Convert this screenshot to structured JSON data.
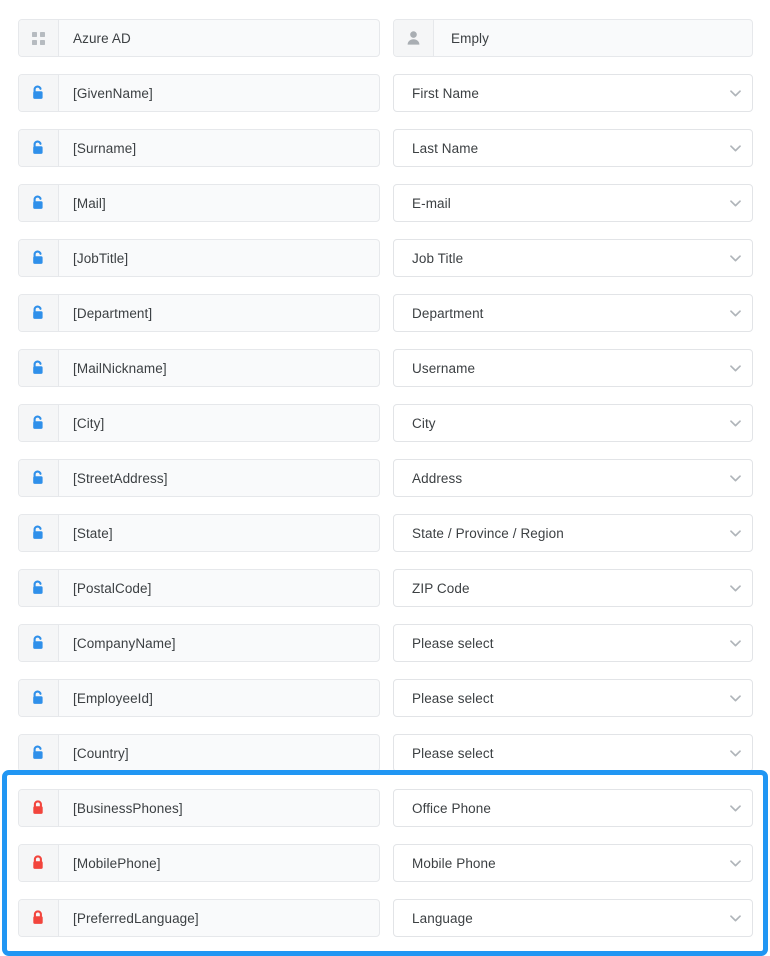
{
  "header": {
    "left": {
      "icon": "grid-icon",
      "label": "Azure AD"
    },
    "right": {
      "icon": "person-icon",
      "label": "Emply"
    }
  },
  "colors": {
    "highlight_border": "#2196f3",
    "lock_open": "#2f90ea",
    "lock_closed": "#f2453d",
    "row_background": "#f9fafb",
    "dropdown_background": "#ffffff"
  },
  "highlight": {
    "visible": true,
    "covers_rows": [
      "[BusinessPhones]",
      "[MobilePhone]",
      "[PreferredLanguage]"
    ]
  },
  "rows": [
    {
      "source": "[GivenName]",
      "target": "First Name",
      "lock": "lock-open-icon",
      "locked": false,
      "highlighted": false
    },
    {
      "source": "[Surname]",
      "target": "Last Name",
      "lock": "lock-open-icon",
      "locked": false,
      "highlighted": false
    },
    {
      "source": "[Mail]",
      "target": "E-mail",
      "lock": "lock-open-icon",
      "locked": false,
      "highlighted": false
    },
    {
      "source": "[JobTitle]",
      "target": "Job Title",
      "lock": "lock-open-icon",
      "locked": false,
      "highlighted": false
    },
    {
      "source": "[Department]",
      "target": "Department",
      "lock": "lock-open-icon",
      "locked": false,
      "highlighted": false
    },
    {
      "source": "[MailNickname]",
      "target": "Username",
      "lock": "lock-open-icon",
      "locked": false,
      "highlighted": false
    },
    {
      "source": "[City]",
      "target": "City",
      "lock": "lock-open-icon",
      "locked": false,
      "highlighted": false
    },
    {
      "source": "[StreetAddress]",
      "target": "Address",
      "lock": "lock-open-icon",
      "locked": false,
      "highlighted": false
    },
    {
      "source": "[State]",
      "target": "State / Province / Region",
      "lock": "lock-open-icon",
      "locked": false,
      "highlighted": false
    },
    {
      "source": "[PostalCode]",
      "target": "ZIP Code",
      "lock": "lock-open-icon",
      "locked": false,
      "highlighted": false
    },
    {
      "source": "[CompanyName]",
      "target": "Please select",
      "lock": "lock-open-icon",
      "locked": false,
      "highlighted": false
    },
    {
      "source": "[EmployeeId]",
      "target": "Please select",
      "lock": "lock-open-icon",
      "locked": false,
      "highlighted": false
    },
    {
      "source": "[Country]",
      "target": "Please select",
      "lock": "lock-open-icon",
      "locked": false,
      "highlighted": false
    },
    {
      "source": "[BusinessPhones]",
      "target": "Office Phone",
      "lock": "lock-closed-icon",
      "locked": true,
      "highlighted": true
    },
    {
      "source": "[MobilePhone]",
      "target": "Mobile Phone",
      "lock": "lock-closed-icon",
      "locked": true,
      "highlighted": true
    },
    {
      "source": "[PreferredLanguage]",
      "target": "Language",
      "lock": "lock-closed-icon",
      "locked": true,
      "highlighted": true
    }
  ]
}
